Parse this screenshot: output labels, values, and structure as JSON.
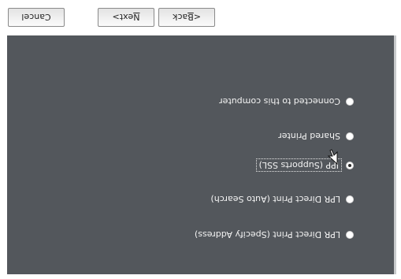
{
  "port_options": [
    {
      "label": "LPR Direct Print (Specify Address)",
      "selected": false
    },
    {
      "label": "LPR Direct Print (Auto Search)",
      "selected": false
    },
    {
      "label": "IPP (Supports SSL)",
      "selected": true
    },
    {
      "label": "Shared Printer",
      "selected": false
    },
    {
      "label": "Connected to this computer",
      "selected": false
    }
  ],
  "buttons": {
    "back_prefix": "< ",
    "back_mnemonic": "B",
    "back_rest": "ack",
    "next_mnemonic": "N",
    "next_rest": "ext",
    "next_suffix": " >",
    "cancel": "Cancel"
  },
  "colors": {
    "panel": "#53575c",
    "panel_edge": "#c7c9cb",
    "text": "#f4f4f4",
    "footer": "#ffffff"
  },
  "icons": {
    "cursor": "mouse-pointer-icon"
  }
}
